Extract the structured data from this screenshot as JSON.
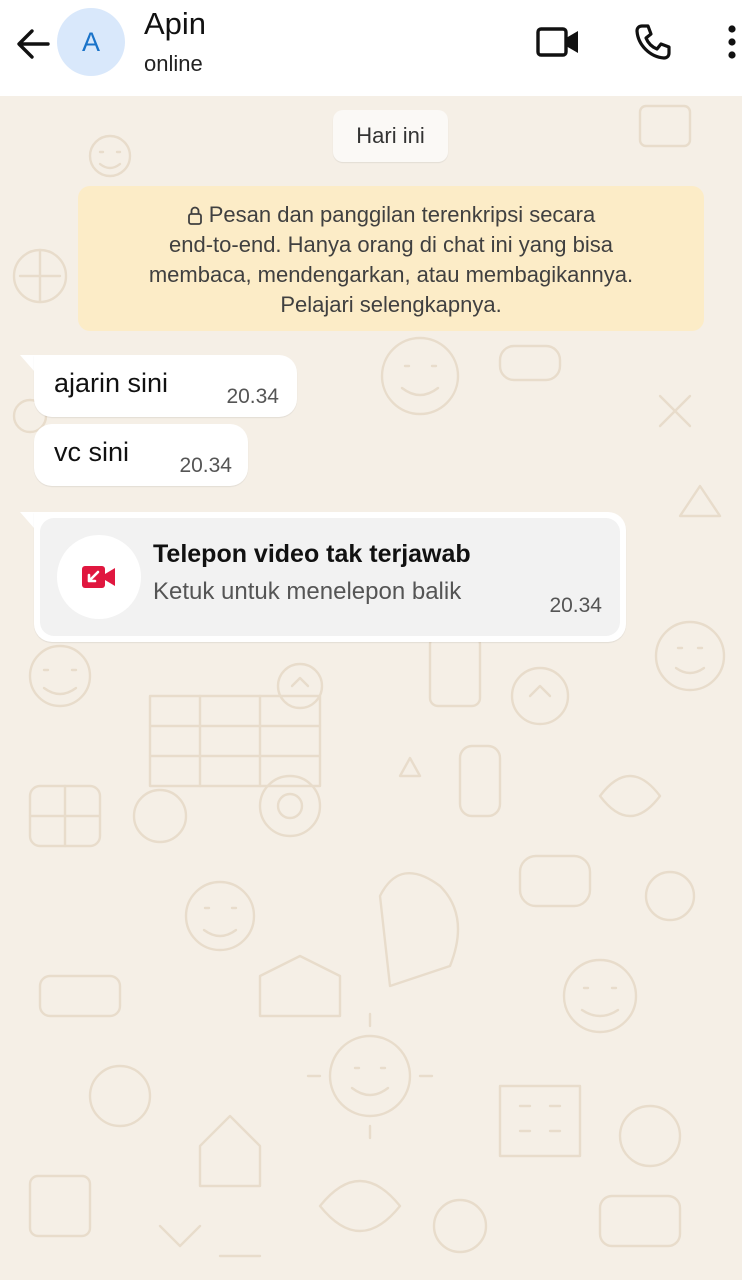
{
  "header": {
    "avatar_initial": "A",
    "contact_name": "Apin",
    "status": "online",
    "icons": [
      "back-arrow-icon",
      "video-call-icon",
      "phone-icon",
      "more-vertical-icon"
    ]
  },
  "chat": {
    "date_chip": "Hari ini",
    "encryption_notice": {
      "line1": "Pesan dan panggilan terenkripsi secara",
      "line2": "end-to-end. Hanya orang di chat ini yang bisa",
      "line3": "membaca, mendengarkan, atau membagikannya.",
      "line4": "Pelajari selengkapnya."
    },
    "messages": [
      {
        "text": "ajarin sini",
        "time": "20.34"
      },
      {
        "text": "vc sini",
        "time": "20.34"
      }
    ],
    "missed_call": {
      "title": "Telepon video tak terjawab",
      "subtitle": "Ketuk untuk menelepon balik",
      "time": "20.34",
      "icon": "missed-video-call-icon"
    }
  },
  "colors": {
    "wallpaper": "#f5efe6",
    "notice_bg": "#fcecc7",
    "missed_call_red": "#e0173f",
    "avatar_bg": "#d9e8fb",
    "avatar_text": "#1a73c9"
  }
}
